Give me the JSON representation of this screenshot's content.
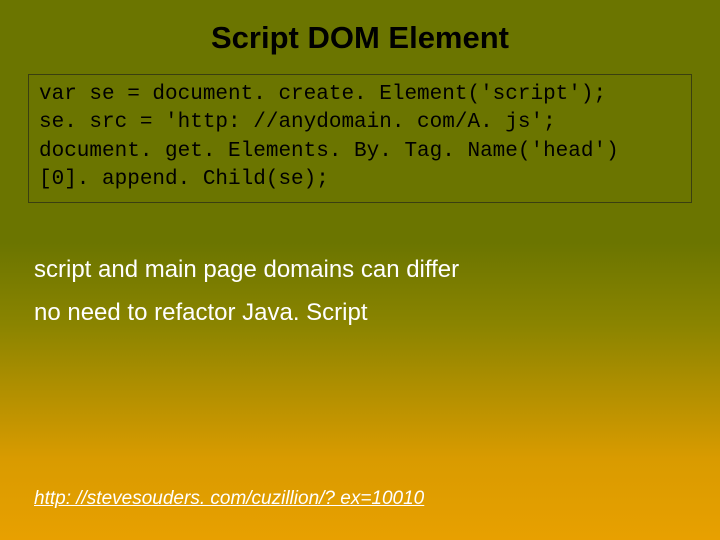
{
  "title": "Script DOM Element",
  "code": {
    "line1": "var se = document. create. Element('script');",
    "line2": "se. src = 'http: //anydomain. com/A. js';",
    "line3": "document. get. Elements. By. Tag. Name('head')",
    "line4": "[0]. append. Child(se);"
  },
  "body": {
    "line1": "script and main page domains can differ",
    "line2": "no need to refactor Java. Script"
  },
  "link": "http: //stevesouders. com/cuzillion/? ex=10010"
}
